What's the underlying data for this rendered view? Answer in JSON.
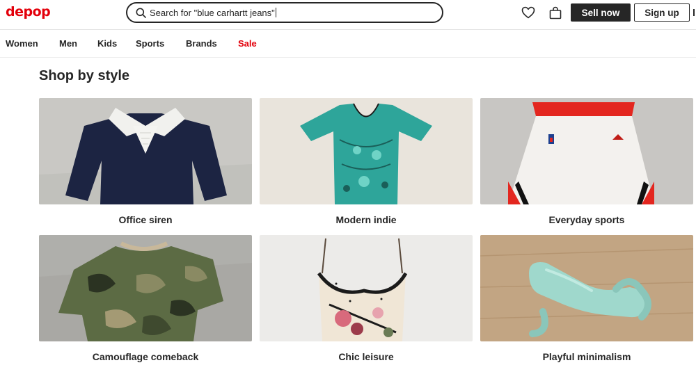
{
  "header": {
    "logo": "depop",
    "search_value": "Search for \"blue carhartt jeans\"",
    "wishlist_icon": "heart-icon",
    "bag_icon": "shopping-bag-icon",
    "sell_label": "Sell now",
    "signup_label": "Sign up"
  },
  "nav": {
    "items": [
      "Women",
      "Men",
      "Kids",
      "Sports",
      "Brands",
      "Sale"
    ],
    "sale_color": "#e3000b"
  },
  "section": {
    "title": "Shop by style",
    "styles": [
      {
        "label": "Office siren"
      },
      {
        "label": "Modern indie"
      },
      {
        "label": "Everyday sports"
      },
      {
        "label": "Camouflage comeback"
      },
      {
        "label": "Chic leisure"
      },
      {
        "label": "Playful minimalism"
      }
    ]
  },
  "colors": {
    "brand": "#e3000b",
    "text": "#262626"
  }
}
